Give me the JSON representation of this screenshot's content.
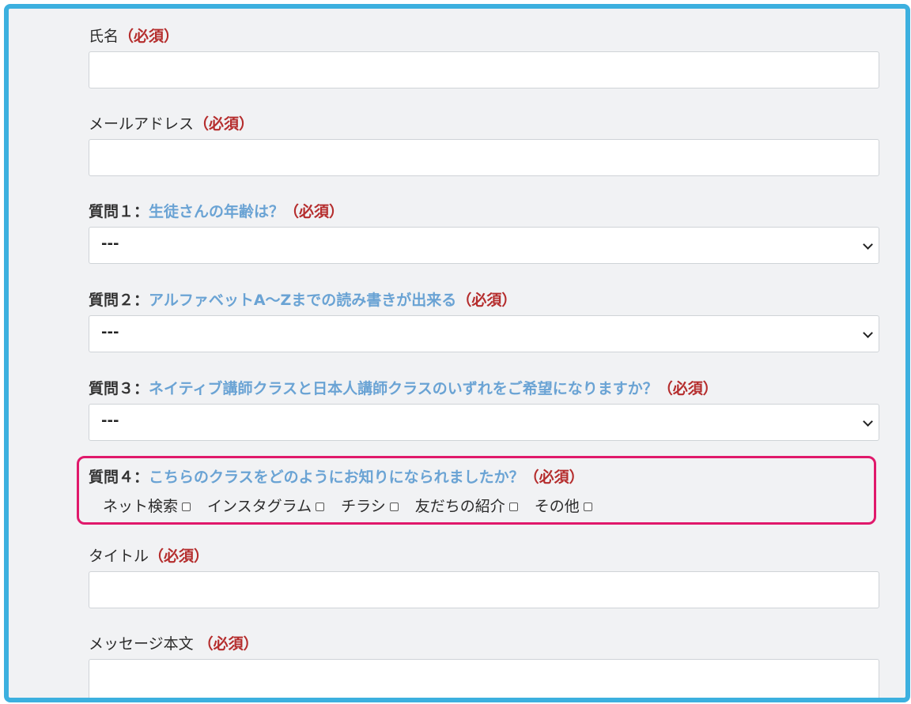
{
  "required_mark": "（必須）",
  "name": {
    "label": "氏名",
    "value": ""
  },
  "email": {
    "label": "メールアドレス",
    "value": ""
  },
  "q1": {
    "prefix": "質問１：",
    "text": "生徒さんの年齢は？",
    "selected": "---"
  },
  "q2": {
    "prefix": "質問２：",
    "text": "アルファベットA～Zまでの読み書きが出来る",
    "selected": "---"
  },
  "q3": {
    "prefix": "質問３：",
    "text": "ネイティブ講師クラスと日本人講師クラスのいずれをご希望になりますか？",
    "selected": "---"
  },
  "q4": {
    "prefix": "質問４：",
    "text": "こちらのクラスをどのようにお知りになられましたか？",
    "options": [
      {
        "label": "ネット検索",
        "checked": false
      },
      {
        "label": "インスタグラム",
        "checked": false
      },
      {
        "label": "チラシ",
        "checked": false
      },
      {
        "label": "友だちの紹介",
        "checked": false
      },
      {
        "label": "その他",
        "checked": false
      }
    ]
  },
  "title": {
    "label": "タイトル",
    "value": ""
  },
  "message": {
    "label": "メッセージ本文 ",
    "value": ""
  },
  "colors": {
    "frame": "#3cb0df",
    "required": "#b52d2d",
    "question_text": "#6aa3d4",
    "highlight": "#e0196b"
  }
}
